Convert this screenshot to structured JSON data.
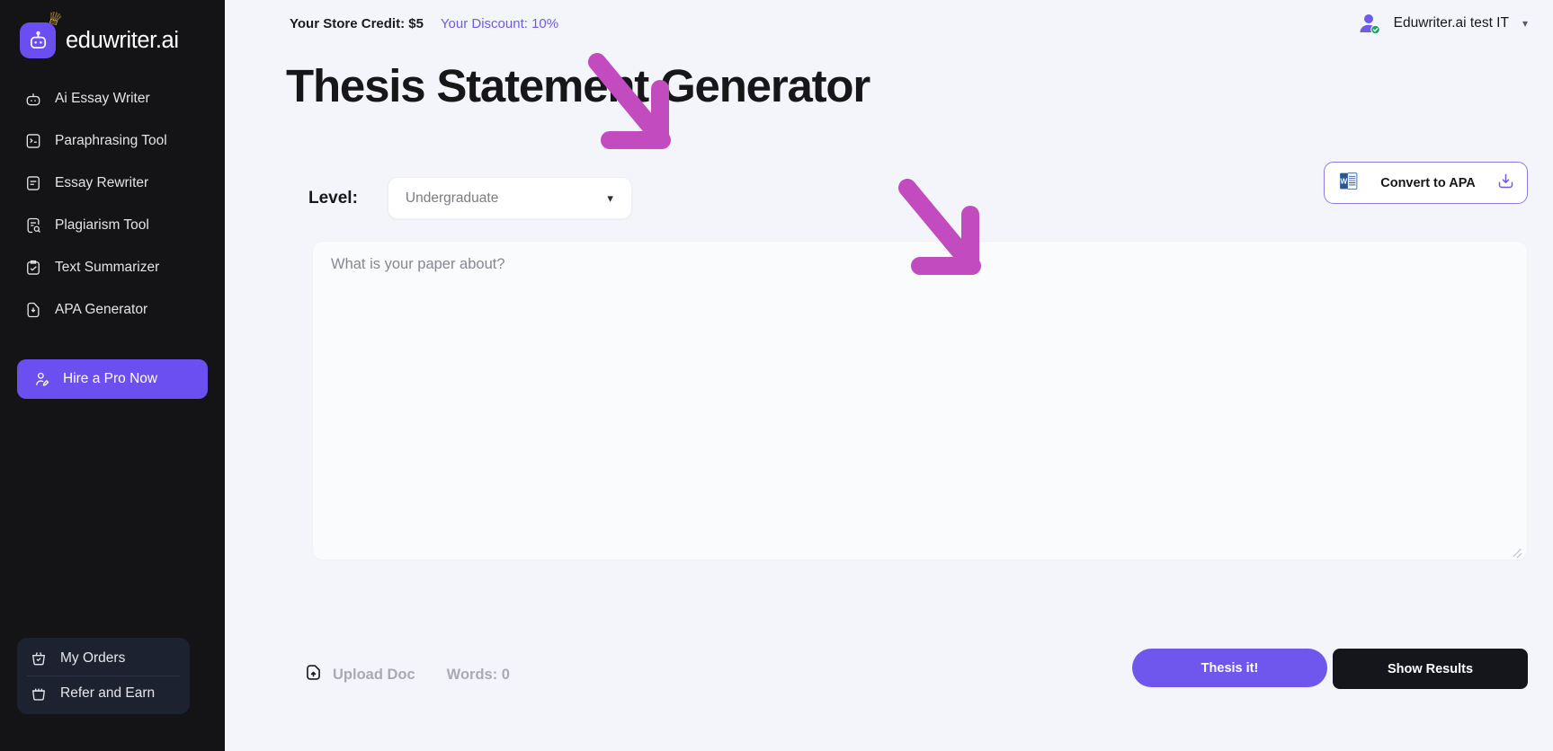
{
  "brand": {
    "name": "eduwriter.ai",
    "icon": "robot-icon",
    "crown_icon": "crown-icon",
    "accent": "#6b4ef2"
  },
  "sidebar": {
    "items": [
      {
        "label": "Ai Essay Writer",
        "icon": "robot-icon"
      },
      {
        "label": "Paraphrasing Tool",
        "icon": "document-check-icon"
      },
      {
        "label": "Essay Rewriter",
        "icon": "document-lines-icon"
      },
      {
        "label": "Plagiarism Tool",
        "icon": "document-search-icon"
      },
      {
        "label": "Text Summarizer",
        "icon": "clipboard-check-icon"
      },
      {
        "label": "APA Generator",
        "icon": "document-download-icon"
      }
    ],
    "hire_button": {
      "label": "Hire a Pro Now",
      "icon": "user-edit-icon",
      "color": "#6c4ff0"
    },
    "bottom_items": [
      {
        "label": "My Orders",
        "icon": "basket-check-icon"
      },
      {
        "label": "Refer and Earn",
        "icon": "gift-basket-icon"
      }
    ]
  },
  "topbar": {
    "store_credit": "Your Store Credit: $5",
    "discount": "Your Discount: 10%",
    "discount_color": "#6c5ce7",
    "user": {
      "name": "Eduwriter.ai test IT",
      "avatar_icon": "user-verified-avatar",
      "chevron": "chevron-down-icon"
    }
  },
  "main": {
    "title": "Thesis Statement Generator",
    "level": {
      "label": "Level:",
      "value": "Undergraduate",
      "chevron": "chevron-down-icon"
    },
    "apa_button": {
      "label": "Convert to APA",
      "doc_icon": "word-document-icon",
      "download_icon": "download-icon"
    },
    "editor": {
      "placeholder": "What is your paper about?",
      "value": ""
    },
    "footer": {
      "upload_label": "Upload Doc",
      "upload_icon": "upload-file-icon",
      "words": "Words: 0",
      "primary_button": "Thesis it!",
      "secondary_button": "Show Results"
    },
    "annotations": [
      {
        "name": "arrow-to-title",
        "color": "#c24bc0",
        "direction": "down-right"
      },
      {
        "name": "arrow-to-editor",
        "color": "#c24bc0",
        "direction": "down-right"
      }
    ]
  }
}
